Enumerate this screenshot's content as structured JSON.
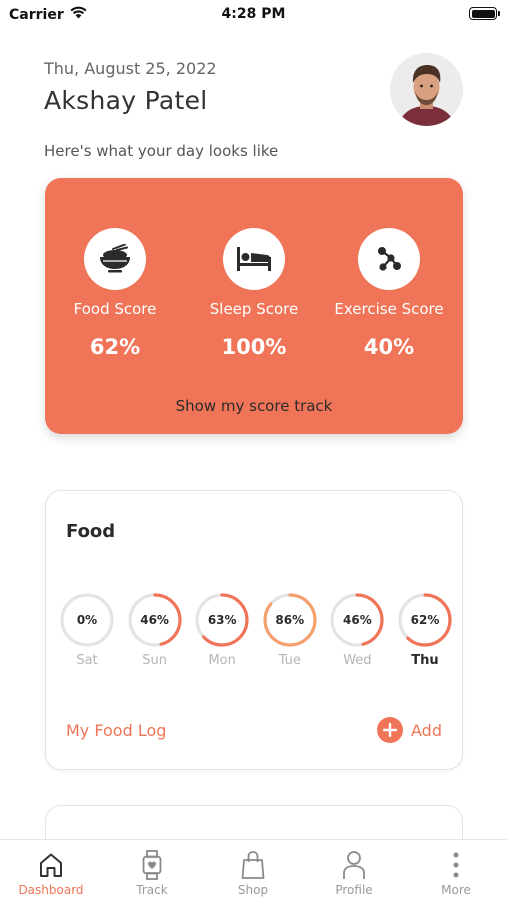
{
  "status_bar": {
    "carrier": "Carrier",
    "time": "4:28 PM"
  },
  "header": {
    "date": "Thu, August 25, 2022",
    "name": "Akshay Patel",
    "subtitle": "Here's what your day looks like"
  },
  "score_card": {
    "background_color": "#f07558",
    "items": [
      {
        "label": "Food Score",
        "value": "62%",
        "icon": "food-bowl-icon"
      },
      {
        "label": "Sleep Score",
        "value": "100%",
        "icon": "bed-icon"
      },
      {
        "label": "Exercise Score",
        "value": "40%",
        "icon": "exercise-icon"
      }
    ],
    "track_link": "Show my score track"
  },
  "food_card": {
    "title": "Food",
    "days": [
      {
        "day": "Sat",
        "percent_label": "0%",
        "percent": 0,
        "active": false
      },
      {
        "day": "Sun",
        "percent_label": "46%",
        "percent": 46,
        "active": false
      },
      {
        "day": "Mon",
        "percent_label": "63%",
        "percent": 63,
        "active": false
      },
      {
        "day": "Tue",
        "percent_label": "86%",
        "percent": 86,
        "active": false
      },
      {
        "day": "Wed",
        "percent_label": "46%",
        "percent": 46,
        "active": false
      },
      {
        "day": "Thu",
        "percent_label": "62%",
        "percent": 62,
        "active": true
      }
    ],
    "log_link": "My Food Log",
    "add_label": "Add"
  },
  "tabs": [
    {
      "label": "Dashboard",
      "icon": "home-icon",
      "active": true
    },
    {
      "label": "Track",
      "icon": "watch-icon",
      "active": false
    },
    {
      "label": "Shop",
      "icon": "shopping-bag-icon",
      "active": false
    },
    {
      "label": "Profile",
      "icon": "person-icon",
      "active": false
    },
    {
      "label": "More",
      "icon": "more-vertical-icon",
      "active": false
    }
  ],
  "colors": {
    "accent": "#f07558",
    "ring_track": "#e4e4e4",
    "ring_fill_light": "#f5a06f"
  }
}
